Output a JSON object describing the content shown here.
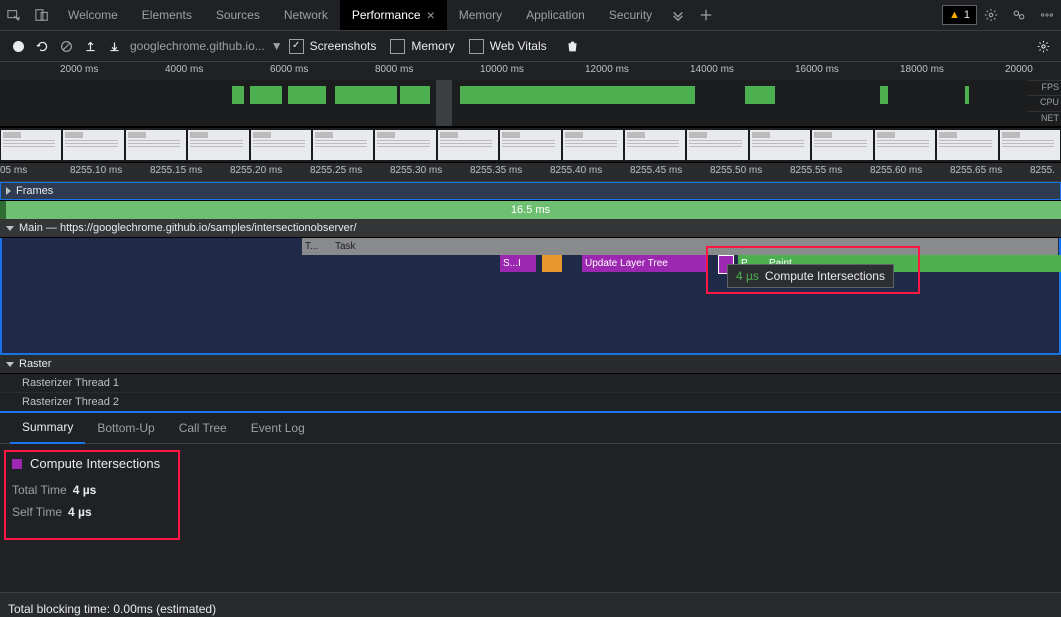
{
  "tabbar": {
    "tabs": [
      "Welcome",
      "Elements",
      "Sources",
      "Network",
      "Performance",
      "Memory",
      "Application",
      "Security"
    ],
    "activeIndex": 4,
    "warnCount": "1"
  },
  "toolbar": {
    "url": "googlechrome.github.io...",
    "screenshots": "Screenshots",
    "memory": "Memory",
    "webvitals": "Web Vitals"
  },
  "overviewRuler": [
    "2000 ms",
    "4000 ms",
    "6000 ms",
    "8000 ms",
    "10000 ms",
    "12000 ms",
    "14000 ms",
    "16000 ms",
    "18000 ms",
    "20000"
  ],
  "ovSide": [
    "FPS",
    "CPU",
    "NET"
  ],
  "detailRuler": [
    "05 ms",
    "8255.10 ms",
    "8255.15 ms",
    "8255.20 ms",
    "8255.25 ms",
    "8255.30 ms",
    "8255.35 ms",
    "8255.40 ms",
    "8255.45 ms",
    "8255.50 ms",
    "8255.55 ms",
    "8255.60 ms",
    "8255.65 ms",
    "8255."
  ],
  "framesHdr": "Frames",
  "framesBar": "16.5 ms",
  "mainHdr": "Main — https://googlechrome.github.io/samples/intersectionobserver/",
  "tasks": {
    "t1": "T...",
    "t2": "Task"
  },
  "events": {
    "si": "S...I",
    "ult": "Update Layer Tree",
    "p": "P...",
    "paint": "Paint"
  },
  "tooltip": {
    "time": "4 µs",
    "name": "Compute Intersections"
  },
  "raster": {
    "hdr": "Raster",
    "r1": "Rasterizer Thread 1",
    "r2": "Rasterizer Thread 2"
  },
  "btabs": [
    "Summary",
    "Bottom-Up",
    "Call Tree",
    "Event Log"
  ],
  "summary": {
    "title": "Compute Intersections",
    "rows": [
      {
        "k": "Total Time",
        "v": "4 µs"
      },
      {
        "k": "Self Time",
        "v": "4 µs"
      }
    ]
  },
  "footer": "Total blocking time: 0.00ms (estimated)"
}
